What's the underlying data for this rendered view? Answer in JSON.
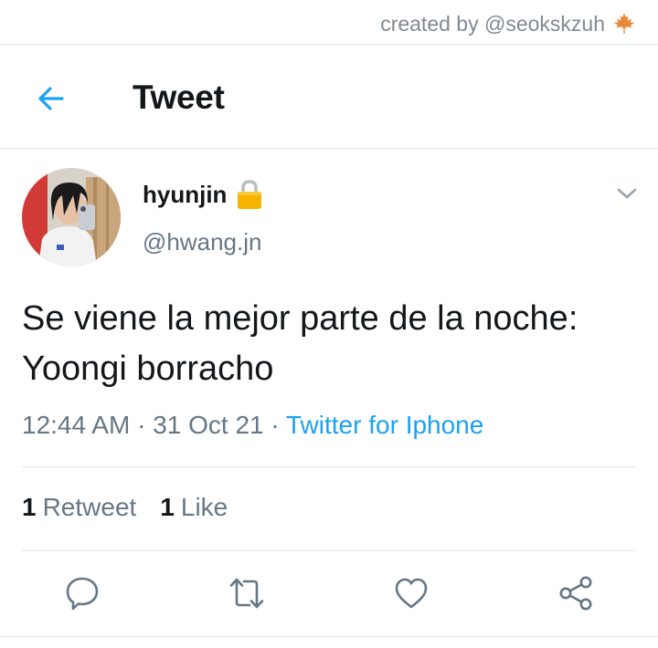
{
  "credit": {
    "text": "created by @seokskzuh",
    "icon": "maple-leaf-icon"
  },
  "header": {
    "title": "Tweet",
    "back_icon": "back-arrow-icon"
  },
  "tweet": {
    "display_name": "hyunjin",
    "handle": "@hwang.jn",
    "text": "Se viene la mejor parte de la noche: Yoongi borracho",
    "time": "12:44 AM",
    "date": "31 Oct 21",
    "separator": "·",
    "source": "Twitter for Iphone"
  },
  "stats": {
    "retweets_count": "1",
    "retweets_label": "Retweet",
    "likes_count": "1",
    "likes_label": "Like"
  },
  "actions": [
    "reply-icon",
    "retweet-icon",
    "like-icon",
    "share-icon"
  ],
  "colors": {
    "accent": "#1da1f2",
    "secondary_text": "#657786",
    "divider": "#e1e8ed",
    "lock": "#f5b400"
  }
}
